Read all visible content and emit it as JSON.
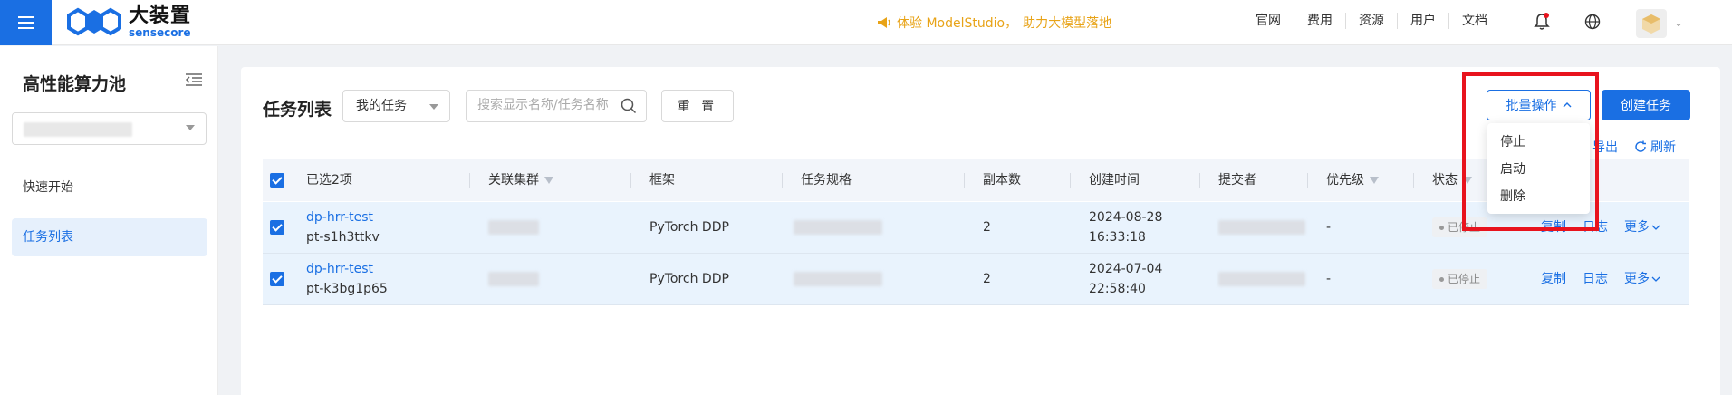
{
  "header": {
    "logo_main": "大装置",
    "logo_sub": "sensecore",
    "promo_prefix": "体验 ModelStudio，",
    "promo_highlight": "助力大模型落地",
    "nav": [
      "官网",
      "费用",
      "资源",
      "用户",
      "文档"
    ]
  },
  "sidebar": {
    "title": "高性能算力池",
    "items": [
      {
        "label": "快速开始"
      },
      {
        "label": "任务列表"
      }
    ]
  },
  "toolbar": {
    "title": "任务列表",
    "filter_value": "我的任务",
    "search_placeholder": "搜索显示名称/任务名称",
    "reset_label": "重 置",
    "batch_label": "批量操作",
    "create_label": "创建任务",
    "export_label": "导出",
    "refresh_label": "刷新"
  },
  "batch_menu": [
    "停止",
    "启动",
    "删除"
  ],
  "table": {
    "columns": [
      "已选2项",
      "关联集群",
      "框架",
      "任务规格",
      "副本数",
      "创建时间",
      "提交者",
      "优先级",
      "状态"
    ],
    "rows": [
      {
        "name": "dp-hrr-test",
        "id": "pt-s1h3ttkv",
        "framework": "PyTorch DDP",
        "replicas": "2",
        "date": "2024-08-28",
        "time": "16:33:18",
        "priority": "-",
        "status": "已停止",
        "actions": [
          "复制",
          "日志",
          "更多"
        ]
      },
      {
        "name": "dp-hrr-test",
        "id": "pt-k3bg1p65",
        "framework": "PyTorch DDP",
        "replicas": "2",
        "date": "2024-07-04",
        "time": "22:58:40",
        "priority": "-",
        "status": "已停止",
        "actions": [
          "复制",
          "日志",
          "更多"
        ]
      }
    ]
  },
  "colors": {
    "primary": "#1a6fe3",
    "promo": "#e8a317",
    "highlight": "#e8131d",
    "row_selected": "#e9f3fd"
  }
}
